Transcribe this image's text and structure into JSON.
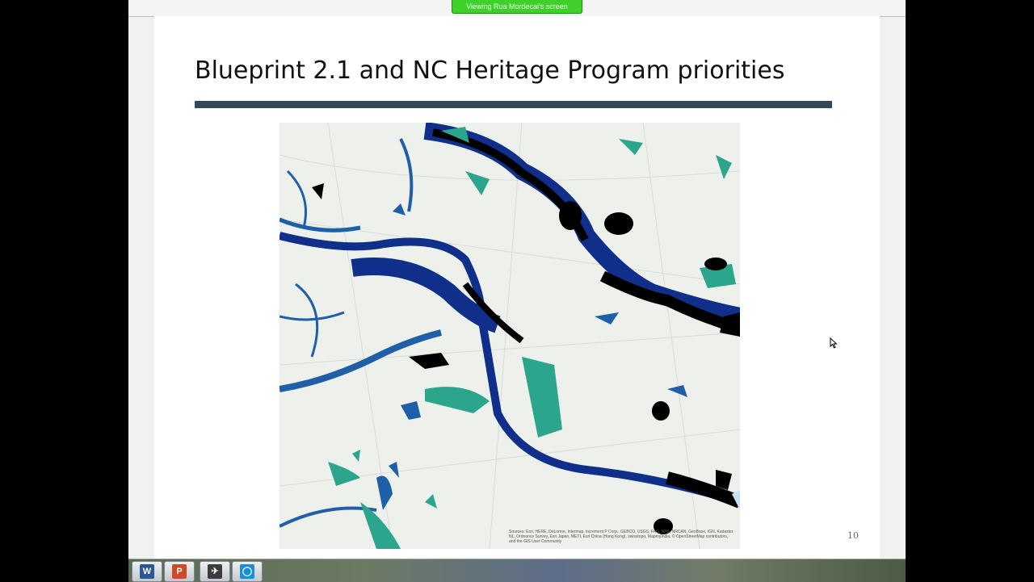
{
  "banner": {
    "text": "Viewing Rua Mordecai's screen"
  },
  "slide": {
    "title": "Blueprint 2.1 and NC Heritage Program priorities",
    "number": "10",
    "map_attribution": "Sources: Esri, HERE, DeLorme, Intermap, increment P Corp., GEBCO, USGS, FAO, NPS, NRCAN, GeoBase, IGN, Kadaster NL, Ordnance Survey, Esri Japan, METI, Esri China (Hong Kong), swisstopo, MapmyIndia, © OpenStreetMap contributors, and the GIS User Community"
  },
  "map_colors": {
    "basemap": "#eef0ec",
    "priority_high": "#0f2f8a",
    "priority_mid": "#1f5fa8",
    "priority_low": "#2ca58d",
    "heritage": "#000000"
  },
  "taskbar": {
    "apps": [
      {
        "icon": "word-icon",
        "glyph": "W",
        "color": "#2b5797"
      },
      {
        "icon": "powerpoint-icon",
        "glyph": "P",
        "color": "#d24726"
      },
      {
        "icon": "gotomeeting-icon",
        "glyph": "✈",
        "color": "#3c3c3c"
      },
      {
        "icon": "browser-icon",
        "glyph": "◯",
        "color": "#1a8fd6"
      }
    ]
  }
}
